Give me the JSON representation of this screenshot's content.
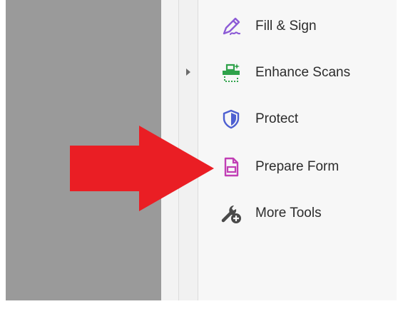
{
  "tools": [
    {
      "id": "fill-sign",
      "label": "Fill & Sign",
      "icon": "pen-signature-icon"
    },
    {
      "id": "enhance-scans",
      "label": "Enhance Scans",
      "icon": "scanner-sparkle-icon"
    },
    {
      "id": "protect",
      "label": "Protect",
      "icon": "shield-icon"
    },
    {
      "id": "prepare-form",
      "label": "Prepare Form",
      "icon": "form-document-icon"
    },
    {
      "id": "more-tools",
      "label": "More Tools",
      "icon": "wrench-plus-icon"
    }
  ],
  "colors": {
    "fill_sign": "#8c5bd6",
    "enhance_scans": "#2fa24a",
    "protect": "#4d5fd1",
    "prepare_form": "#c13fb5",
    "more_tools": "#4a4a4a",
    "arrow": "#ea1e24"
  }
}
